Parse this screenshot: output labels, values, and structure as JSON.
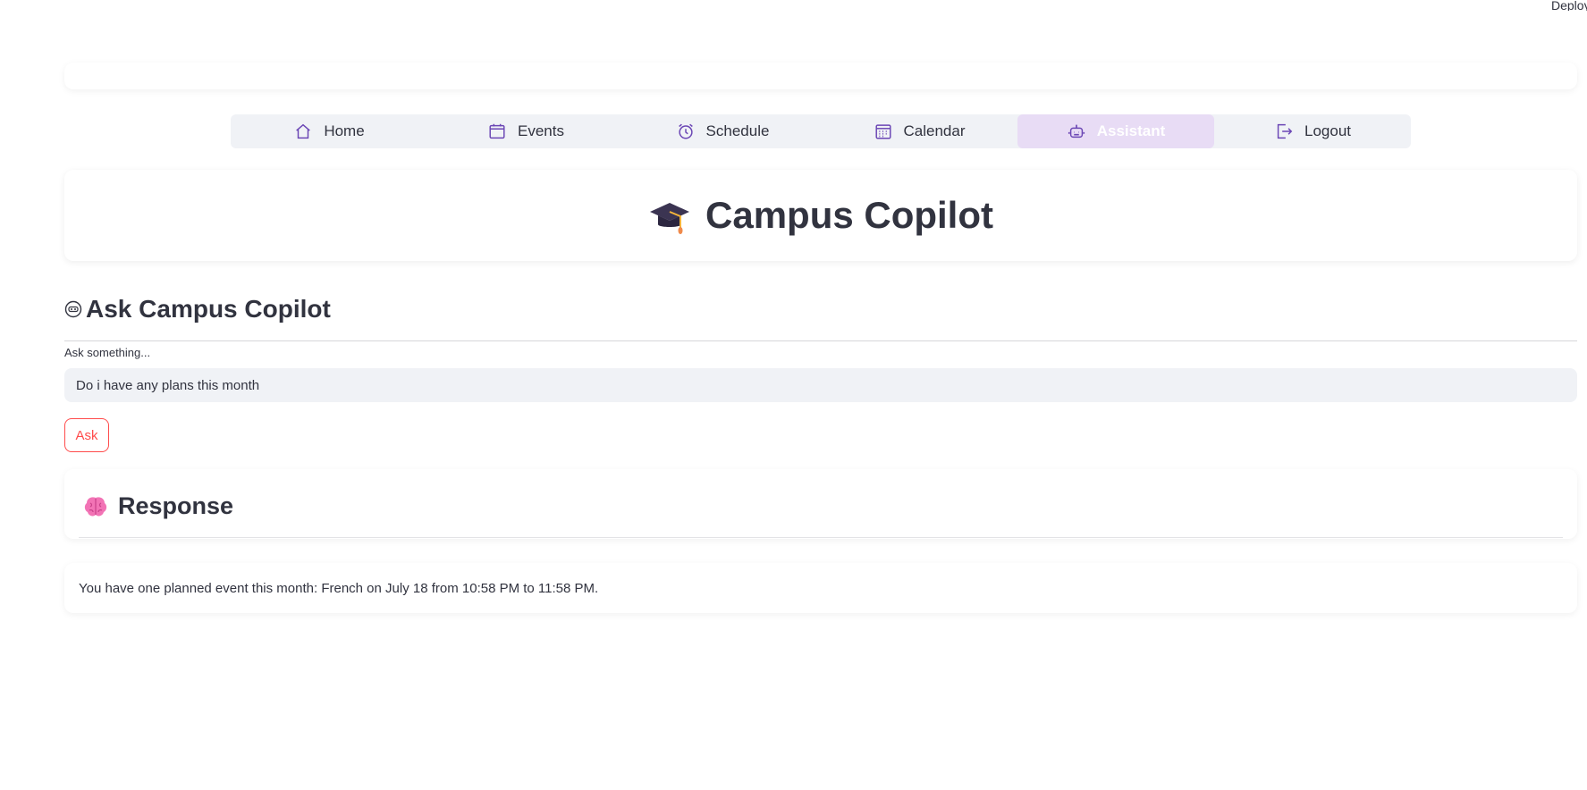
{
  "deploy_label": "Deploy",
  "nav": {
    "items": [
      {
        "label": "Home",
        "icon": "home-icon"
      },
      {
        "label": "Events",
        "icon": "calendar-blank-icon"
      },
      {
        "label": "Schedule",
        "icon": "alarm-clock-icon"
      },
      {
        "label": "Calendar",
        "icon": "calendar-grid-icon"
      },
      {
        "label": "Assistant",
        "icon": "robot-icon",
        "active": true
      },
      {
        "label": "Logout",
        "icon": "logout-icon"
      }
    ],
    "active_bg": "#e8dcf5",
    "icon_color": "#6b46b5"
  },
  "header": {
    "title": "Campus Copilot",
    "icon": "graduation-cap-icon"
  },
  "ask_section": {
    "title": "Ask Campus Copilot",
    "icon": "robot-face-icon",
    "input_label": "Ask something...",
    "input_value": "Do i have any plans this month",
    "button_label": "Ask",
    "button_color": "#ff4b4b"
  },
  "response": {
    "title": "Response",
    "icon": "brain-icon",
    "answer": "You have one planned event this month: French on July 18 from 10:58 PM to 11:58 PM."
  }
}
